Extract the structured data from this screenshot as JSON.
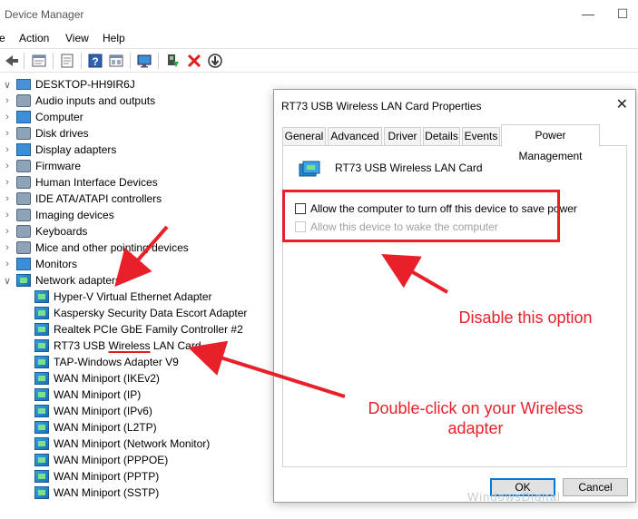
{
  "window": {
    "title": "Device Manager"
  },
  "menu": [
    "Action",
    "View",
    "Help"
  ],
  "menu_partial_first": "e",
  "toolbar": {
    "icons": [
      "back-icon",
      "properties-icon",
      "refresh-icon",
      "help-icon",
      "show-hidden-icon",
      "monitor-icon",
      "update-driver-icon",
      "uninstall-icon",
      "disable-icon"
    ],
    "uninstall_color": "#e01e1e"
  },
  "tree": {
    "root": "DESKTOP-HH9IR6J",
    "categories": [
      "Audio inputs and outputs",
      "Computer",
      "Disk drives",
      "Display adapters",
      "Firmware",
      "Human Interface Devices",
      "IDE ATA/ATAPI controllers",
      "Imaging devices",
      "Keyboards",
      "Mice and other pointing devices",
      "Monitors",
      "Network adapters"
    ],
    "network_adapters": [
      "Hyper-V Virtual Ethernet Adapter",
      "Kaspersky Security Data Escort Adapter",
      "Realtek PCIe GbE Family Controller #2",
      "RT73 USB Wireless LAN Card",
      "TAP-Windows Adapter V9",
      "WAN Miniport (IKEv2)",
      "WAN Miniport (IP)",
      "WAN Miniport (IPv6)",
      "WAN Miniport (L2TP)",
      "WAN Miniport (Network Monitor)",
      "WAN Miniport (PPPOE)",
      "WAN Miniport (PPTP)",
      "WAN Miniport (SSTP)"
    ],
    "rt73_parts": [
      "RT73 USB ",
      "Wireless",
      " LAN Card"
    ]
  },
  "dialog": {
    "title": "RT73 USB Wireless LAN Card Properties",
    "tabs": [
      "General",
      "Advanced",
      "Driver",
      "Details",
      "Events",
      "Power Management"
    ],
    "active_tab": "Power Management",
    "device_name": "RT73 USB Wireless LAN Card",
    "option_power": "Allow the computer to turn off this device to save power",
    "option_power_checked": false,
    "option_wake": "Allow this device to wake the computer",
    "option_wake_enabled": false,
    "ok": "OK",
    "cancel": "Cancel"
  },
  "annotations": {
    "disable": "Disable this option",
    "double_click_line1": "Double-click on your Wireless",
    "double_click_line2": "adapter",
    "color": "#e8202a"
  },
  "watermark": "WindowsDigital"
}
